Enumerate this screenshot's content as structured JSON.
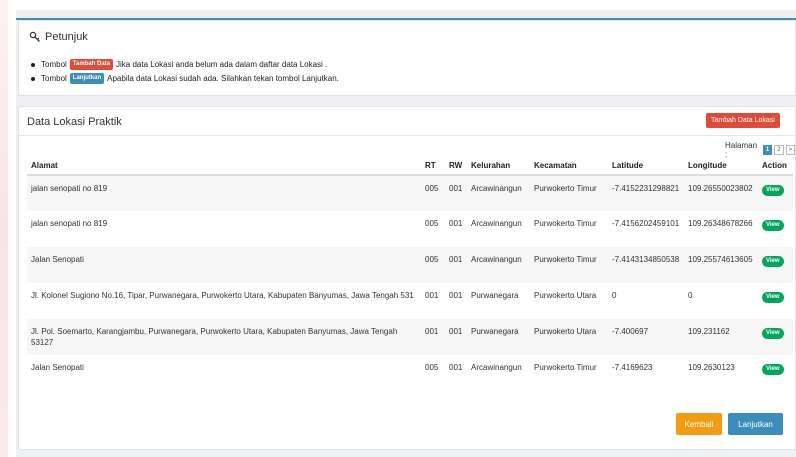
{
  "petunjuk": {
    "title": "Petunjuk",
    "line1_prefix": "Tombol",
    "line1_badge": "Tambah Data",
    "line1_text": "Jika data Lokasi anda belum ada dalam daftar data Lokasi .",
    "line2_prefix": "Tombol",
    "line2_badge": "Lanjutkan",
    "line2_text": "Apabila data Lokasi sudah ada. Silahkan tekan tombol Lanjutkan."
  },
  "data_panel": {
    "title": "Data Lokasi Praktik",
    "add_button": "Tambah Data Lokasi",
    "pagination": {
      "label": "Halaman :",
      "pages": [
        "1",
        "2",
        ">"
      ],
      "current": "1"
    },
    "columns": [
      "Alamat",
      "RT",
      "RW",
      "Kelurahan",
      "Kecamatan",
      "Latitude",
      "Longitude",
      "Action"
    ],
    "rows": [
      {
        "alamat": "jalan senopati no 819",
        "rt": "005",
        "rw": "001",
        "kelurahan": "Arcawinangun",
        "kecamatan": "Purwokerto Timur",
        "latitude": "-7.4152231298821",
        "longitude": "109.26550023802",
        "action": "View"
      },
      {
        "alamat": "jalan senopati no 819",
        "rt": "005",
        "rw": "001",
        "kelurahan": "Arcawinangun",
        "kecamatan": "Purwokerto Timur",
        "latitude": "-7.4156202459101",
        "longitude": "109.26348678266",
        "action": "View"
      },
      {
        "alamat": "Jalan Senopati",
        "rt": "005",
        "rw": "001",
        "kelurahan": "Arcawinangun",
        "kecamatan": "Purwokerto Timur",
        "latitude": "-7.4143134850538",
        "longitude": "109.25574613605",
        "action": "View"
      },
      {
        "alamat": "Jl. Kolonel Sugiono No.16, Tipar, Purwanegara, Purwokerto Utara, Kabupaten Banyumas, Jawa Tengah 531",
        "rt": "001",
        "rw": "001",
        "kelurahan": "Purwanegara",
        "kecamatan": "Purwokerto Utara",
        "latitude": "0",
        "longitude": "0",
        "action": "View"
      },
      {
        "alamat": "Jl. Pol. Soemarto, Karangjambu, Purwanegara, Purwokerto Utara, Kabupaten Banyumas, Jawa Tengah 53127",
        "rt": "001",
        "rw": "001",
        "kelurahan": "Purwanegara",
        "kecamatan": "Purwokerto Utara",
        "latitude": "-7.400697",
        "longitude": "109.231162",
        "action": "View"
      },
      {
        "alamat": "Jalan Senopati",
        "rt": "005",
        "rw": "001",
        "kelurahan": "Arcawinangun",
        "kecamatan": "Purwokerto Timur",
        "latitude": "-7.4169623",
        "longitude": "109.2630123",
        "action": "View"
      }
    ],
    "back_button": "Kembali",
    "next_button": "Lanjutkan"
  },
  "colors": {
    "primary": "#3c8dbc",
    "danger": "#dd4b39",
    "success": "#00a65a",
    "warning": "#f39c12"
  },
  "icons": {
    "petunjuk": "key-icon"
  }
}
